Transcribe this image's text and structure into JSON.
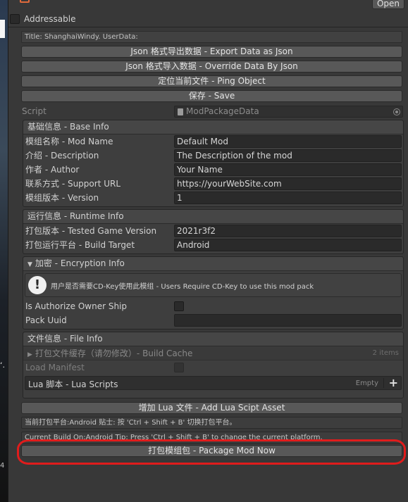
{
  "header": {
    "open_button": "Open",
    "addressable_label": "Addressable"
  },
  "title_box": "Title: ShanghaiWindy. UserData:",
  "actions": {
    "export_json": "Json 格式导出数据 - Export Data as Json",
    "import_json": "Json 格式导入数据 - Override Data By Json",
    "ping_object": "定位当前文件 - Ping Object",
    "save": "保存 - Save"
  },
  "script": {
    "label": "Script",
    "value": "ModPackageData"
  },
  "base_info": {
    "header": "基础信息 - Base Info",
    "rows": [
      {
        "label": "模组名称 - Mod Name",
        "value": "Default Mod"
      },
      {
        "label": "介绍 - Description",
        "value": "The Description of the mod"
      },
      {
        "label": "作者 - Author",
        "value": "Your Name"
      },
      {
        "label": "联系方式 - Support URL",
        "value": "https://yourWebSite.com"
      },
      {
        "label": "模组版本 - Version",
        "value": "1"
      }
    ]
  },
  "runtime_info": {
    "header": "运行信息 - Runtime Info",
    "rows": [
      {
        "label": "打包版本 - Tested Game Version",
        "value": "2021r3f2"
      },
      {
        "label": "打包运行平台 - Build Target",
        "value": "Android"
      }
    ]
  },
  "encryption_info": {
    "header": "加密 - Encryption Info",
    "help_text": "用户是否需要CD-Key使用此模组 - Users Require CD-Key to use this mod pack",
    "authorize_label": "Is Authorize Owner Ship",
    "pack_uuid_label": "Pack Uuid",
    "pack_uuid_value": ""
  },
  "file_info": {
    "header": "文件信息 - File Info",
    "build_cache_label": "打包文件缓存（请勿修改）- Build Cache",
    "build_cache_count": "2 items",
    "load_manifest_label": "Load Manifest",
    "lua_scripts_label": "Lua 脚本 - Lua Scripts",
    "lua_scripts_empty": "Empty"
  },
  "add_lua_button": "增加 Lua 文件 - Add Lua Scipt Asset",
  "platform_note": "当前打包平台:Android   贴士: 按 'Ctrl + Shift + B' 切换打包平台。",
  "platform_note_en": "Current Build On:Android   Tip: Press 'Ctrl + Shift + B' to change the current platform.",
  "package_button": "打包模组包 - Package Mod Now",
  "colors": {
    "annotation_ring": "#e01c1c",
    "panel_bg": "#383838",
    "button_bg": "#585858"
  }
}
